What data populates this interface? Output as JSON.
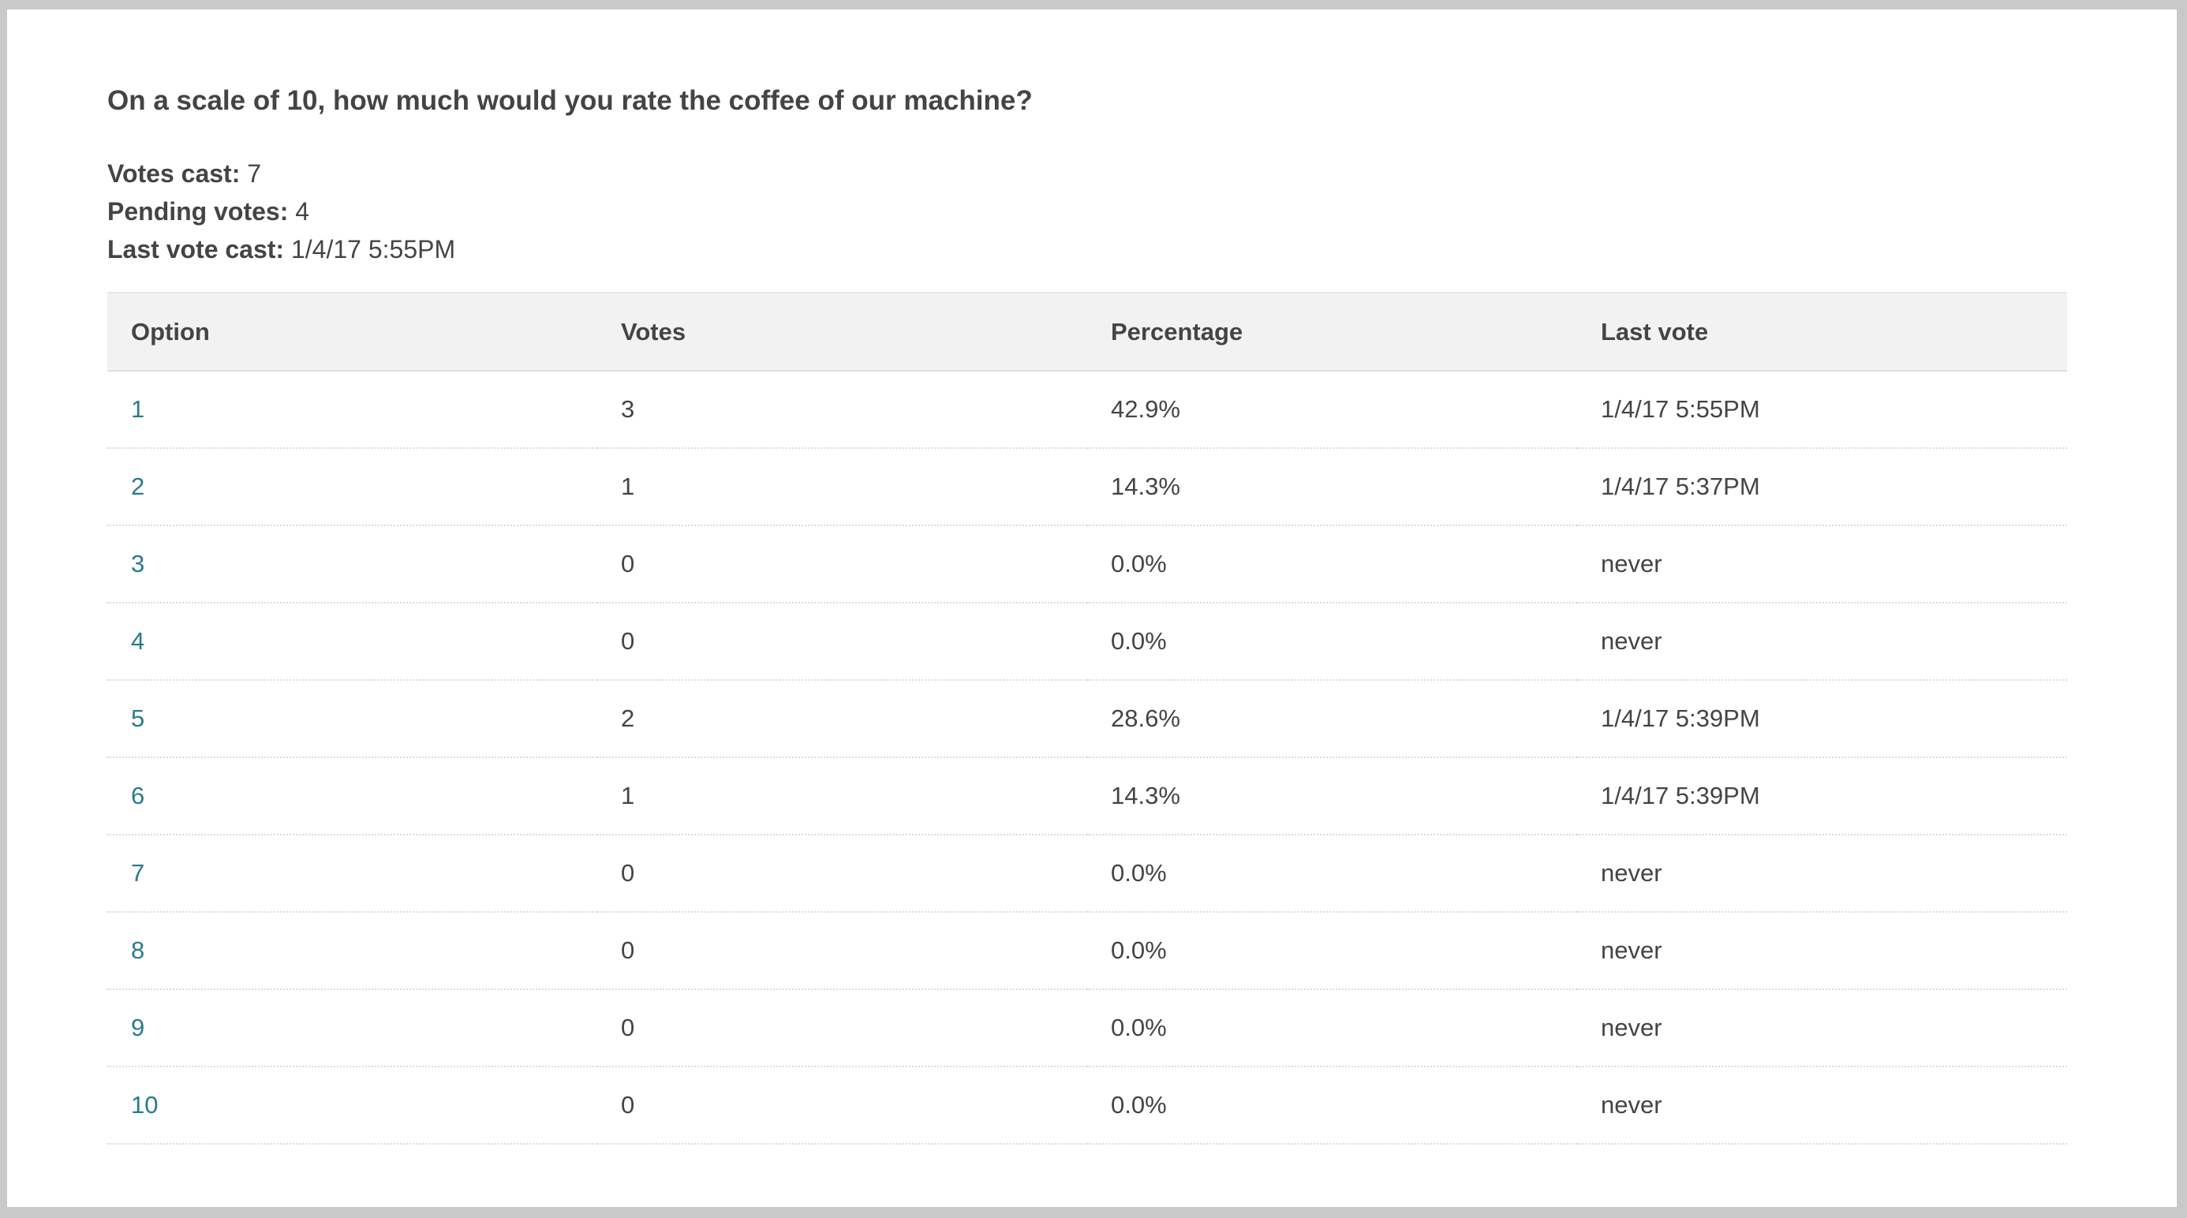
{
  "poll": {
    "question": "On a scale of 10, how much would you rate the coffee of our machine?",
    "stats": {
      "votes_cast_label": "Votes cast:",
      "votes_cast_value": "7",
      "pending_label": "Pending votes:",
      "pending_value": "4",
      "last_vote_label": "Last vote cast:",
      "last_vote_value": "1/4/17 5:55PM"
    }
  },
  "table": {
    "headers": {
      "option": "Option",
      "votes": "Votes",
      "percentage": "Percentage",
      "last_vote": "Last vote"
    },
    "rows": [
      {
        "option": "1",
        "votes": "3",
        "percentage": "42.9%",
        "last_vote": "1/4/17 5:55PM"
      },
      {
        "option": "2",
        "votes": "1",
        "percentage": "14.3%",
        "last_vote": "1/4/17 5:37PM"
      },
      {
        "option": "3",
        "votes": "0",
        "percentage": "0.0%",
        "last_vote": "never"
      },
      {
        "option": "4",
        "votes": "0",
        "percentage": "0.0%",
        "last_vote": "never"
      },
      {
        "option": "5",
        "votes": "2",
        "percentage": "28.6%",
        "last_vote": "1/4/17 5:39PM"
      },
      {
        "option": "6",
        "votes": "1",
        "percentage": "14.3%",
        "last_vote": "1/4/17 5:39PM"
      },
      {
        "option": "7",
        "votes": "0",
        "percentage": "0.0%",
        "last_vote": "never"
      },
      {
        "option": "8",
        "votes": "0",
        "percentage": "0.0%",
        "last_vote": "never"
      },
      {
        "option": "9",
        "votes": "0",
        "percentage": "0.0%",
        "last_vote": "never"
      },
      {
        "option": "10",
        "votes": "0",
        "percentage": "0.0%",
        "last_vote": "never"
      }
    ]
  },
  "colors": {
    "link": "#2a7a8c",
    "header_bg": "#f2f2f2",
    "text": "#444444"
  }
}
